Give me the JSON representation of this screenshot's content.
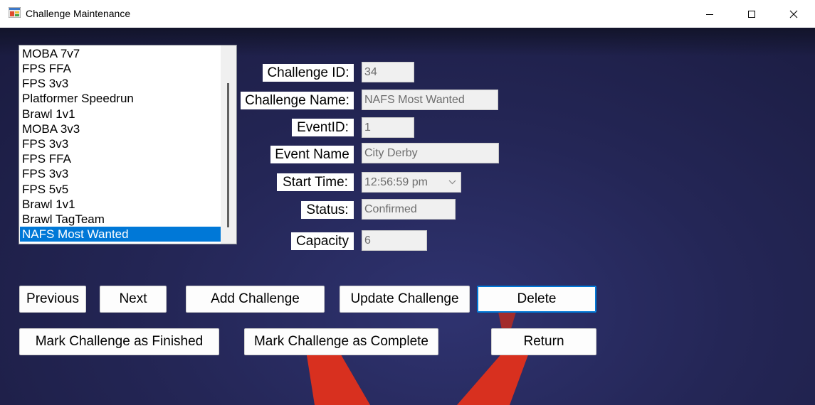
{
  "window": {
    "title": "Challenge Maintenance",
    "app_icon": "winforms-app-icon",
    "controls": [
      "minimize-icon",
      "maximize-icon",
      "close-icon"
    ]
  },
  "challenge_list": {
    "items": [
      "MOBA 7v7",
      "FPS FFA",
      "FPS 3v3",
      "Platformer Speedrun",
      "Brawl 1v1",
      "MOBA 3v3",
      "FPS 3v3",
      "FPS FFA",
      "FPS 3v3",
      "FPS 5v5",
      "Brawl 1v1",
      "Brawl TagTeam",
      "NAFS Most Wanted"
    ],
    "selected_index": 12
  },
  "form": {
    "challenge_id_label": "Challenge ID:",
    "challenge_id_value": "34",
    "challenge_name_label": "Challenge Name:",
    "challenge_name_value": "NAFS Most Wanted",
    "event_id_label": "EventID:",
    "event_id_value": "1",
    "event_name_label": "Event Name",
    "event_name_value": "City Derby",
    "start_time_label": "Start Time:",
    "start_time_value": "12:56:59 pm",
    "status_label": "Status:",
    "status_value": "Confirmed",
    "capacity_label": "Capacity",
    "capacity_value": "6"
  },
  "buttons": {
    "previous": "Previous",
    "next": "Next",
    "add_challenge": "Add Challenge",
    "update_challenge": "Update Challenge",
    "delete": "Delete",
    "mark_finished": "Mark Challenge as Finished",
    "mark_complete": "Mark Challenge as Complete",
    "return": "Return"
  },
  "colors": {
    "selection": "#0078d7",
    "background": "#242656",
    "spotlight": "#d8301f"
  }
}
